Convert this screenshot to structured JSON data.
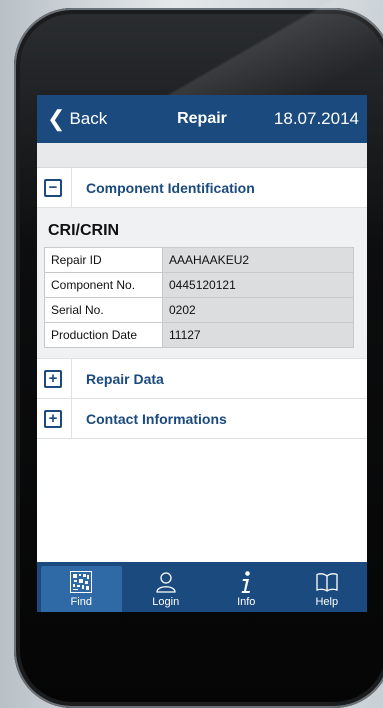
{
  "navbar": {
    "back_label": "Back",
    "title": "Repair",
    "date": "18.07.2014"
  },
  "sections": {
    "component_identification": {
      "label": "Component Identification",
      "toggle": "−"
    },
    "repair_data": {
      "label": "Repair Data",
      "toggle": "+"
    },
    "contact_informations": {
      "label": "Contact Informations",
      "toggle": "+"
    }
  },
  "detail": {
    "title": "CRI/CRIN",
    "rows": [
      {
        "label": "Repair ID",
        "value": "AAAHAAKEU2"
      },
      {
        "label": "Component No.",
        "value": "0445120121"
      },
      {
        "label": "Serial No.",
        "value": "0202"
      },
      {
        "label": "Production Date",
        "value": "11127"
      }
    ]
  },
  "tabbar": {
    "tabs": [
      {
        "label": "Find",
        "icon": "barcode-icon",
        "active": true
      },
      {
        "label": "Login",
        "icon": "user-icon",
        "active": false
      },
      {
        "label": "Info",
        "icon": "info-icon",
        "active": false
      },
      {
        "label": "Help",
        "icon": "book-icon",
        "active": false
      }
    ]
  },
  "colors": {
    "brand": "#1a4a7e",
    "active_tab": "#2f6aa6"
  }
}
